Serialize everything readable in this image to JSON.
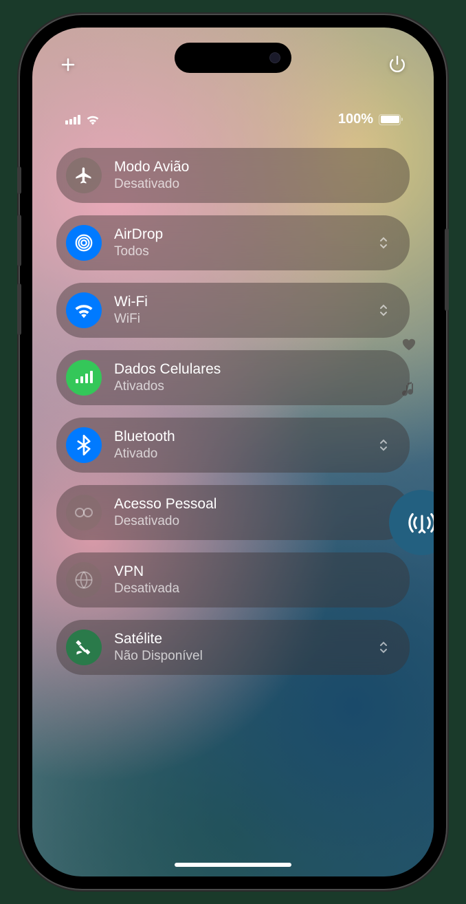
{
  "status": {
    "battery_text": "100%"
  },
  "tiles": [
    {
      "title": "Modo Avião",
      "subtitle": "Desativado"
    },
    {
      "title": "AirDrop",
      "subtitle": "Todos"
    },
    {
      "title": "Wi-Fi",
      "subtitle": "WiFi"
    },
    {
      "title": "Dados Celulares",
      "subtitle": "Ativados"
    },
    {
      "title": "Bluetooth",
      "subtitle": "Ativado"
    },
    {
      "title": "Acesso Pessoal",
      "subtitle": "Desativado"
    },
    {
      "title": "VPN",
      "subtitle": "Desativada"
    },
    {
      "title": "Satélite",
      "subtitle": "Não Disponível"
    }
  ]
}
